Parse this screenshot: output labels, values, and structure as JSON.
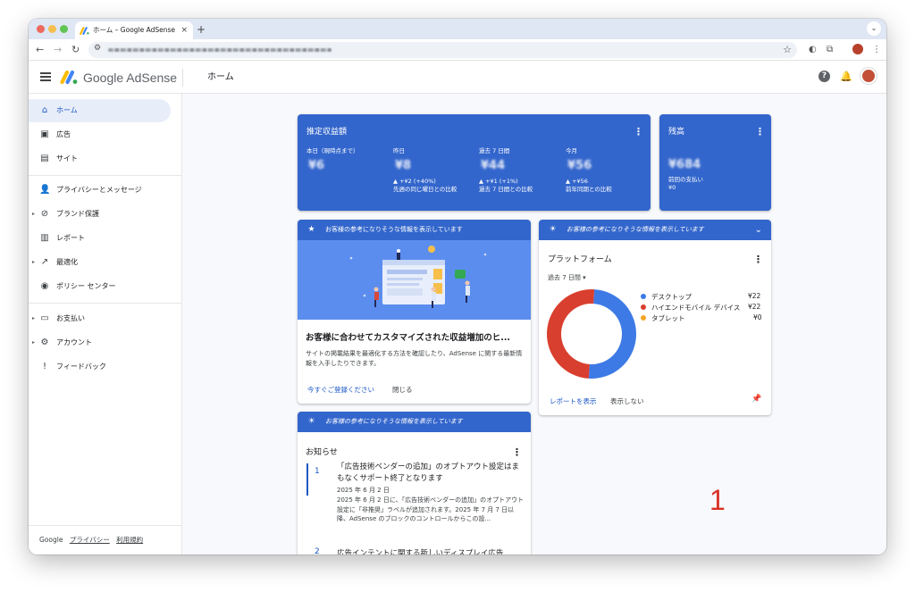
{
  "browser": {
    "tab_title": "ホーム – Google AdSense",
    "tab_close": "×",
    "new_tab": "+",
    "tab_menu": "⌄",
    "back": "←",
    "forward": "→",
    "reload": "↻",
    "star": "☆"
  },
  "header": {
    "brand": "Google AdSense",
    "page_title": "ホーム",
    "help": "?",
    "bell": "🔔"
  },
  "sidebar": {
    "items": [
      {
        "label": "ホーム",
        "icon": "home-icon",
        "glyph": "⌂"
      },
      {
        "label": "広告",
        "icon": "ads-icon",
        "glyph": "▣"
      },
      {
        "label": "サイト",
        "icon": "sites-icon",
        "glyph": "▤"
      },
      {
        "label": "プライバシーとメッセージ",
        "icon": "privacy-icon",
        "glyph": "👤"
      },
      {
        "label": "ブランド保護",
        "icon": "block-icon",
        "glyph": "⊘"
      },
      {
        "label": "レポート",
        "icon": "report-icon",
        "glyph": "▥"
      },
      {
        "label": "最適化",
        "icon": "trend-icon",
        "glyph": "↗"
      },
      {
        "label": "ポリシー センター",
        "icon": "policy-icon",
        "glyph": "◉"
      },
      {
        "label": "お支払い",
        "icon": "payments-icon",
        "glyph": "▭"
      },
      {
        "label": "アカウント",
        "icon": "gear-icon",
        "glyph": "⚙"
      },
      {
        "label": "フィードバック",
        "icon": "feedback-icon",
        "glyph": "!"
      }
    ],
    "expand_glyph": "▸",
    "footer": {
      "google": "Google",
      "privacy": "プライバシー",
      "terms": "利用規約"
    }
  },
  "earnings": {
    "title": "推定収益額",
    "kebab": "⋮",
    "cols": [
      {
        "label": "本日（現時点まで）",
        "value": "¥6",
        "change": "",
        "compare": ""
      },
      {
        "label": "昨日",
        "value": "¥8",
        "change": "▲ +¥2 (+40%)",
        "compare": "先週の同じ曜日との比較"
      },
      {
        "label": "過去 7 日間",
        "value": "¥44",
        "change": "▲ +¥1 (+1%)",
        "compare": "過去 7 日間との比較"
      },
      {
        "label": "今月",
        "value": "¥56",
        "change": "▲ +¥56",
        "compare": "前年同期との比較"
      }
    ]
  },
  "balance": {
    "title": "残高",
    "value": "¥684",
    "last_payment_label": "前回の支払い",
    "last_payment": "¥0"
  },
  "banner_text": "お客様の参考になりそうな情報を表示しています",
  "promo": {
    "title": "お客様に合わせてカスタマイズされた収益増加のヒ...",
    "body": "サイトの掲載結果を最適化する方法を確認したり、AdSense に関する最新情報を入手したりできます。",
    "cta": "今すぐご登録ください",
    "close": "閉じる"
  },
  "platform": {
    "title": "プラットフォーム",
    "period": "過去 7 日間 ▾",
    "legend": [
      {
        "name": "デスクトップ",
        "value": "¥22",
        "color": "#3d7ae6"
      },
      {
        "name": "ハイエンドモバイル デバイス",
        "value": "¥22",
        "color": "#d93f2e"
      },
      {
        "name": "タブレット",
        "value": "¥0",
        "color": "#f4a626"
      }
    ],
    "report_link": "レポートを表示",
    "hide": "表示しない",
    "pin": "📌",
    "collapse": "⌄"
  },
  "chart_data": {
    "type": "pie",
    "categories": [
      "デスクトップ",
      "ハイエンドモバイル デバイス",
      "タブレット"
    ],
    "values": [
      22,
      22,
      0
    ],
    "colors": [
      "#3d7ae6",
      "#d93f2e",
      "#f4a626"
    ]
  },
  "news": {
    "title": "お知らせ",
    "items": [
      {
        "num": "1",
        "title": "「広告技術ベンダーの追加」のオプトアウト設定はまもなくサポート終了となります",
        "date": "2025 年 6 月 2 日",
        "body": "2025 年 6 月 2 日に、「広告技術ベンダーの追加」のオプトアウト設定に「非推奨」ラベルが追加されます。2025 年 7 月 7 日以降、AdSense のブロックのコントロールからこの設..."
      },
      {
        "num": "2",
        "title": "広告インテントに関する新しいディスプレイ広告"
      }
    ]
  },
  "page_marker": "1"
}
